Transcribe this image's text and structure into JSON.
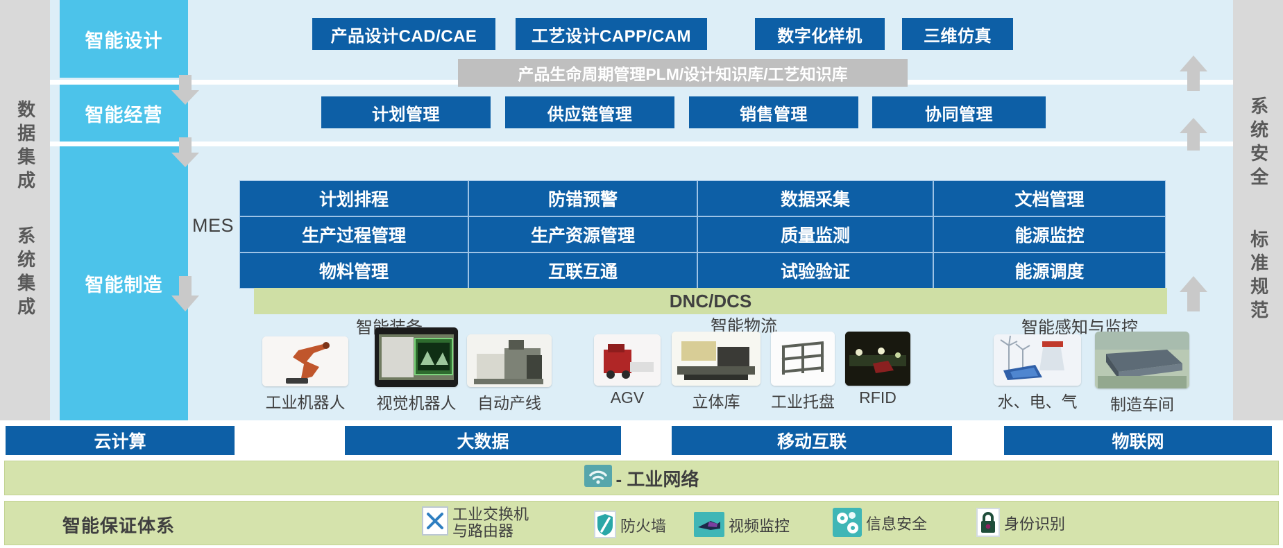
{
  "rails": {
    "left": {
      "top_label": "数据集成",
      "bottom_label": "系统集成"
    },
    "right": {
      "top_label": "系统安全",
      "bottom_label": "标准规范"
    }
  },
  "layers": [
    {
      "id": "design",
      "label": "智能设计"
    },
    {
      "id": "operate",
      "label": "智能经营"
    },
    {
      "id": "make",
      "label": "智能制造"
    }
  ],
  "design_row": {
    "boxes": [
      "产品设计CAD/CAE",
      "工艺设计CAPP/CAM",
      "数字化样机",
      "三维仿真"
    ],
    "plm": "产品生命周期管理PLM/设计知识库/工艺知识库"
  },
  "operate_row": {
    "boxes": [
      "计划管理",
      "供应链管理",
      "销售管理",
      "协同管理"
    ]
  },
  "mes": {
    "label": "MES",
    "rows": [
      [
        "计划排程",
        "防错预警",
        "数据采集",
        "文档管理"
      ],
      [
        "生产过程管理",
        "生产资源管理",
        "质量监测",
        "能源监控"
      ],
      [
        "物料管理",
        "互联互通",
        "试验验证",
        "能源调度"
      ]
    ]
  },
  "dnc": {
    "label": "DNC/DCS"
  },
  "device_groups": [
    {
      "title": "智能装备",
      "items": [
        {
          "caption": "工业机器人",
          "icon": "industrial-robot-photo"
        },
        {
          "caption": "视觉机器人",
          "icon": "vision-robot-photo"
        },
        {
          "caption": "自动产线",
          "icon": "automatic-production-line-photo"
        }
      ]
    },
    {
      "title": "智能物流",
      "items": [
        {
          "caption": "AGV",
          "icon": "agv-photo"
        },
        {
          "caption": "立体库",
          "icon": "stereo-warehouse-photo"
        },
        {
          "caption": "工业托盘",
          "icon": "industrial-pallet-photo"
        },
        {
          "caption": "RFID",
          "icon": "rfid-photo"
        }
      ]
    },
    {
      "title": "智能感知与监控",
      "items": [
        {
          "caption": "水、电、气",
          "icon": "utilities-photo"
        },
        {
          "caption": "制造车间",
          "icon": "factory-workshop-photo"
        }
      ]
    }
  ],
  "infra_bars": [
    "云计算",
    "大数据",
    "移动互联",
    "物联网"
  ],
  "network_band": {
    "icon": "wifi-icon",
    "label": "- 工业网络"
  },
  "assurance": {
    "title": "智能保证体系",
    "items": [
      {
        "icon": "switch-router-icon",
        "label": "工业交换机\n与路由器"
      },
      {
        "icon": "firewall-shield-icon",
        "label": "防火墙"
      },
      {
        "icon": "video-camera-icon",
        "label": "视频监控"
      },
      {
        "icon": "gears-security-icon",
        "label": "信息安全"
      },
      {
        "icon": "lock-icon",
        "label": "身份识别"
      }
    ]
  },
  "colors": {
    "primary_blue": "#0d5fa6",
    "layer_cyan": "#4cc3ea",
    "panel_blue": "#ddeef7",
    "rail_grey": "#d9d9d9",
    "green": "#d5e3ac",
    "dnc_green": "#cfdfa5",
    "plm_grey": "#bfbfbf"
  }
}
